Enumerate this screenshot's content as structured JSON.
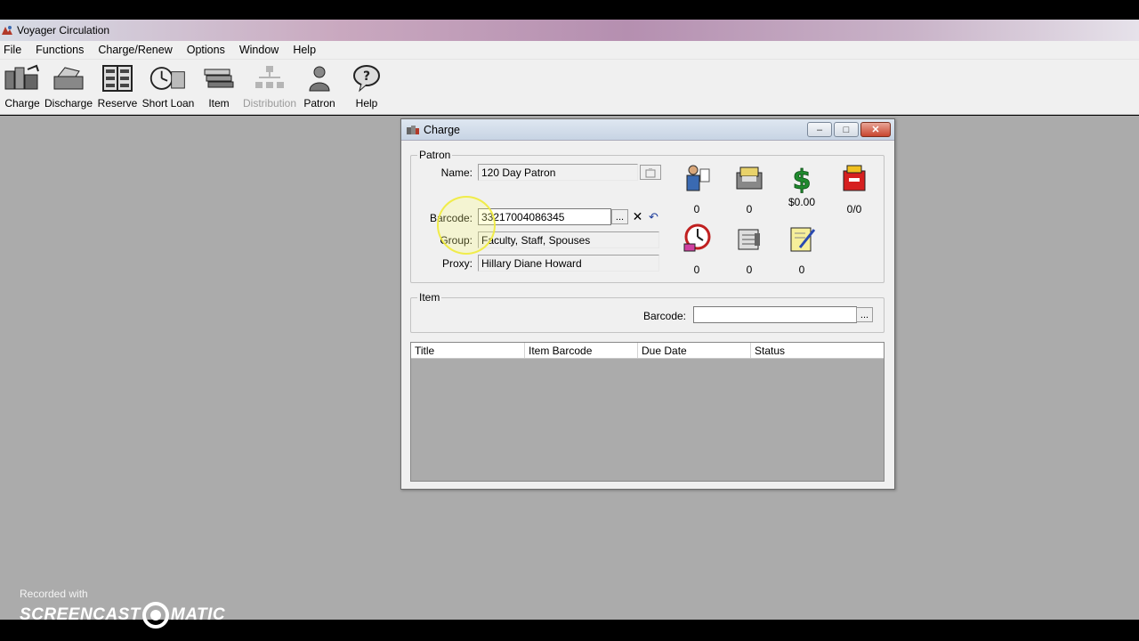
{
  "app": {
    "title": "Voyager Circulation"
  },
  "menu": [
    "File",
    "Functions",
    "Charge/Renew",
    "Options",
    "Window",
    "Help"
  ],
  "toolbar": [
    {
      "label": "Charge",
      "icon": "charge-icon",
      "enabled": true
    },
    {
      "label": "Discharge",
      "icon": "discharge-icon",
      "enabled": true
    },
    {
      "label": "Reserve",
      "icon": "reserve-icon",
      "enabled": true
    },
    {
      "label": "Short Loan",
      "icon": "short-loan-icon",
      "enabled": true
    },
    {
      "label": "Item",
      "icon": "item-icon",
      "enabled": true
    },
    {
      "label": "Distribution",
      "icon": "distribution-icon",
      "enabled": false
    },
    {
      "label": "Patron",
      "icon": "patron-icon",
      "enabled": true
    },
    {
      "label": "Help",
      "icon": "help-icon",
      "enabled": true
    }
  ],
  "dialog": {
    "title": "Charge",
    "window_buttons": {
      "minimize": "–",
      "maximize": "□",
      "close": "✕"
    },
    "patron": {
      "group_label": "Patron",
      "name_label": "Name:",
      "name_value": "120 Day Patron",
      "barcode_label": "Barcode:",
      "barcode_value": "33217004086345",
      "group_field_label": "Group:",
      "group_value": "Faculty, Staff, Spouses",
      "proxy_label": "Proxy:",
      "proxy_value": "Hillary Diane Howard",
      "lookup_button": "..."
    },
    "stats": [
      {
        "icon": "patron-notes-icon",
        "value": "0"
      },
      {
        "icon": "charged-items-icon",
        "value": "0"
      },
      {
        "icon": "fines-dollar-icon",
        "value": "$0.00"
      },
      {
        "icon": "blocks-icon",
        "value": "0/0"
      },
      {
        "icon": "overdue-clock-icon",
        "value": "0"
      },
      {
        "icon": "holds-icon",
        "value": "0"
      },
      {
        "icon": "requests-icon",
        "value": "0"
      }
    ],
    "item": {
      "group_label": "Item",
      "barcode_label": "Barcode:",
      "barcode_value": "",
      "lookup_button": "..."
    },
    "table": {
      "columns": [
        "Title",
        "Item Barcode",
        "Due Date",
        "Status"
      ],
      "rows": []
    }
  },
  "watermark": {
    "recorded_with": "Recorded with",
    "brand_left": "SCREENCAST",
    "brand_right": "MATIC"
  },
  "colors": {
    "workspace": "#ababab",
    "dialog_bg": "#f0f0f0",
    "close_button": "#c8452e",
    "fines_green": "#1f8a2e"
  }
}
